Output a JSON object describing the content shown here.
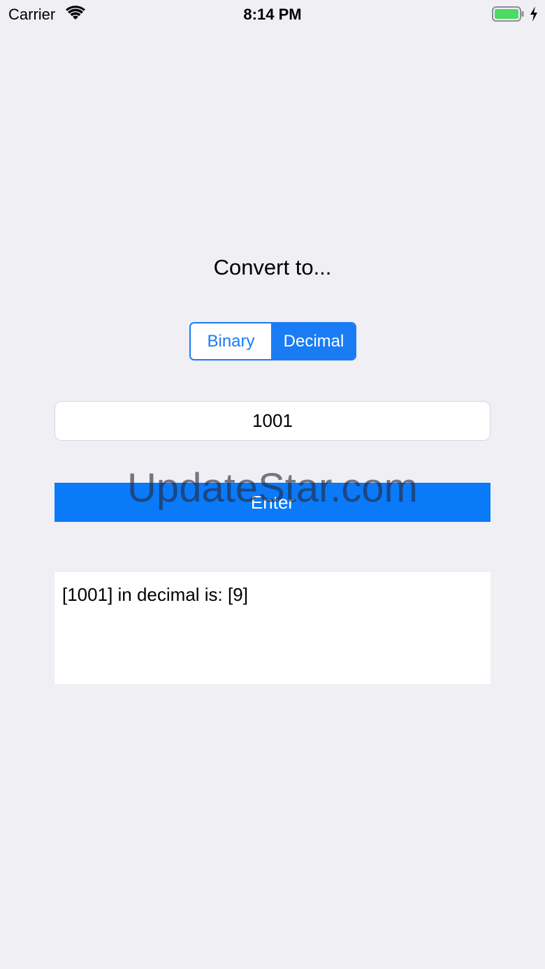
{
  "status_bar": {
    "carrier": "Carrier",
    "time": "8:14 PM",
    "wifi_icon": "wifi-icon",
    "battery_icon": "battery-icon",
    "charging_icon": "lightning-bolt-icon",
    "battery_color": "#4cd964"
  },
  "converter": {
    "prompt": "Convert to...",
    "segments": [
      {
        "label": "Binary",
        "selected": false
      },
      {
        "label": "Decimal",
        "selected": true
      }
    ],
    "input_value": "1001",
    "enter_label": "Enter",
    "result_text": "[1001] in decimal is: [9]"
  },
  "watermark": {
    "text": "UpdateStar.com"
  },
  "colors": {
    "accent": "#1a7cf5",
    "button": "#0a7af8",
    "background": "#efeff4"
  }
}
